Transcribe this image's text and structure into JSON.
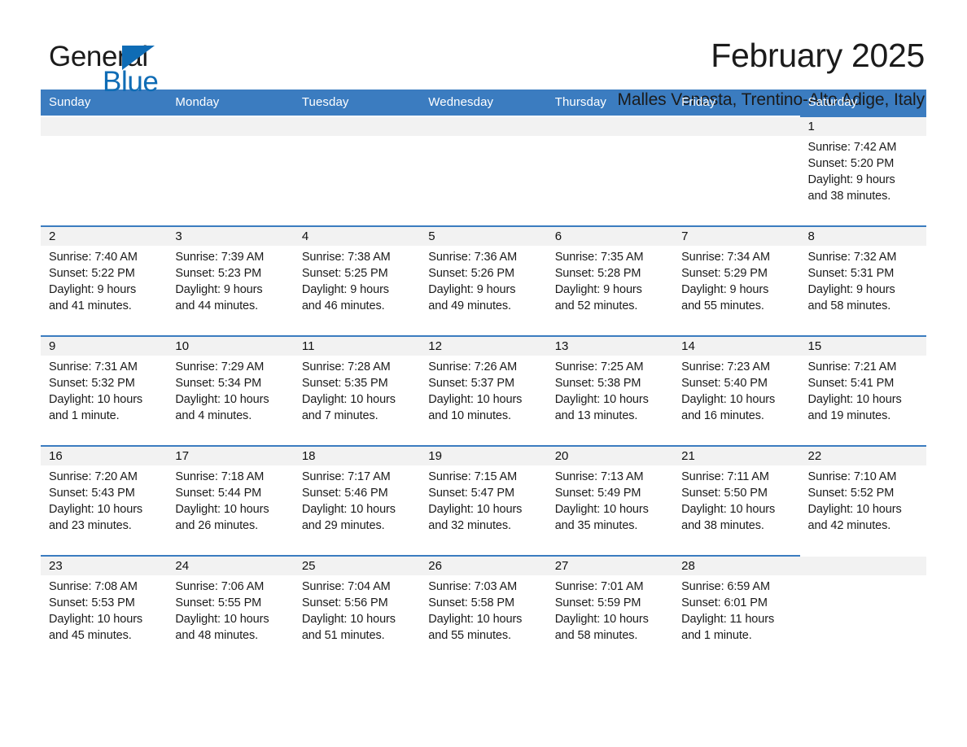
{
  "brand": {
    "name_first": "General",
    "name_second": "Blue",
    "accent_color": "#0f6cb5"
  },
  "header": {
    "title": "February 2025",
    "subtitle": "Malles Venosta, Trentino-Alto Adige, Italy"
  },
  "calendar": {
    "header_color": "#3b7cc0",
    "daynum_band_color": "#f2f2f2",
    "weekdays": [
      "Sunday",
      "Monday",
      "Tuesday",
      "Wednesday",
      "Thursday",
      "Friday",
      "Saturday"
    ],
    "weeks": [
      [
        {
          "empty": true
        },
        {
          "empty": true
        },
        {
          "empty": true
        },
        {
          "empty": true
        },
        {
          "empty": true
        },
        {
          "empty": true
        },
        {
          "day": "1",
          "sunrise": "Sunrise: 7:42 AM",
          "sunset": "Sunset: 5:20 PM",
          "daylight1": "Daylight: 9 hours",
          "daylight2": "and 38 minutes."
        }
      ],
      [
        {
          "day": "2",
          "sunrise": "Sunrise: 7:40 AM",
          "sunset": "Sunset: 5:22 PM",
          "daylight1": "Daylight: 9 hours",
          "daylight2": "and 41 minutes."
        },
        {
          "day": "3",
          "sunrise": "Sunrise: 7:39 AM",
          "sunset": "Sunset: 5:23 PM",
          "daylight1": "Daylight: 9 hours",
          "daylight2": "and 44 minutes."
        },
        {
          "day": "4",
          "sunrise": "Sunrise: 7:38 AM",
          "sunset": "Sunset: 5:25 PM",
          "daylight1": "Daylight: 9 hours",
          "daylight2": "and 46 minutes."
        },
        {
          "day": "5",
          "sunrise": "Sunrise: 7:36 AM",
          "sunset": "Sunset: 5:26 PM",
          "daylight1": "Daylight: 9 hours",
          "daylight2": "and 49 minutes."
        },
        {
          "day": "6",
          "sunrise": "Sunrise: 7:35 AM",
          "sunset": "Sunset: 5:28 PM",
          "daylight1": "Daylight: 9 hours",
          "daylight2": "and 52 minutes."
        },
        {
          "day": "7",
          "sunrise": "Sunrise: 7:34 AM",
          "sunset": "Sunset: 5:29 PM",
          "daylight1": "Daylight: 9 hours",
          "daylight2": "and 55 minutes."
        },
        {
          "day": "8",
          "sunrise": "Sunrise: 7:32 AM",
          "sunset": "Sunset: 5:31 PM",
          "daylight1": "Daylight: 9 hours",
          "daylight2": "and 58 minutes."
        }
      ],
      [
        {
          "day": "9",
          "sunrise": "Sunrise: 7:31 AM",
          "sunset": "Sunset: 5:32 PM",
          "daylight1": "Daylight: 10 hours",
          "daylight2": "and 1 minute."
        },
        {
          "day": "10",
          "sunrise": "Sunrise: 7:29 AM",
          "sunset": "Sunset: 5:34 PM",
          "daylight1": "Daylight: 10 hours",
          "daylight2": "and 4 minutes."
        },
        {
          "day": "11",
          "sunrise": "Sunrise: 7:28 AM",
          "sunset": "Sunset: 5:35 PM",
          "daylight1": "Daylight: 10 hours",
          "daylight2": "and 7 minutes."
        },
        {
          "day": "12",
          "sunrise": "Sunrise: 7:26 AM",
          "sunset": "Sunset: 5:37 PM",
          "daylight1": "Daylight: 10 hours",
          "daylight2": "and 10 minutes."
        },
        {
          "day": "13",
          "sunrise": "Sunrise: 7:25 AM",
          "sunset": "Sunset: 5:38 PM",
          "daylight1": "Daylight: 10 hours",
          "daylight2": "and 13 minutes."
        },
        {
          "day": "14",
          "sunrise": "Sunrise: 7:23 AM",
          "sunset": "Sunset: 5:40 PM",
          "daylight1": "Daylight: 10 hours",
          "daylight2": "and 16 minutes."
        },
        {
          "day": "15",
          "sunrise": "Sunrise: 7:21 AM",
          "sunset": "Sunset: 5:41 PM",
          "daylight1": "Daylight: 10 hours",
          "daylight2": "and 19 minutes."
        }
      ],
      [
        {
          "day": "16",
          "sunrise": "Sunrise: 7:20 AM",
          "sunset": "Sunset: 5:43 PM",
          "daylight1": "Daylight: 10 hours",
          "daylight2": "and 23 minutes."
        },
        {
          "day": "17",
          "sunrise": "Sunrise: 7:18 AM",
          "sunset": "Sunset: 5:44 PM",
          "daylight1": "Daylight: 10 hours",
          "daylight2": "and 26 minutes."
        },
        {
          "day": "18",
          "sunrise": "Sunrise: 7:17 AM",
          "sunset": "Sunset: 5:46 PM",
          "daylight1": "Daylight: 10 hours",
          "daylight2": "and 29 minutes."
        },
        {
          "day": "19",
          "sunrise": "Sunrise: 7:15 AM",
          "sunset": "Sunset: 5:47 PM",
          "daylight1": "Daylight: 10 hours",
          "daylight2": "and 32 minutes."
        },
        {
          "day": "20",
          "sunrise": "Sunrise: 7:13 AM",
          "sunset": "Sunset: 5:49 PM",
          "daylight1": "Daylight: 10 hours",
          "daylight2": "and 35 minutes."
        },
        {
          "day": "21",
          "sunrise": "Sunrise: 7:11 AM",
          "sunset": "Sunset: 5:50 PM",
          "daylight1": "Daylight: 10 hours",
          "daylight2": "and 38 minutes."
        },
        {
          "day": "22",
          "sunrise": "Sunrise: 7:10 AM",
          "sunset": "Sunset: 5:52 PM",
          "daylight1": "Daylight: 10 hours",
          "daylight2": "and 42 minutes."
        }
      ],
      [
        {
          "day": "23",
          "sunrise": "Sunrise: 7:08 AM",
          "sunset": "Sunset: 5:53 PM",
          "daylight1": "Daylight: 10 hours",
          "daylight2": "and 45 minutes."
        },
        {
          "day": "24",
          "sunrise": "Sunrise: 7:06 AM",
          "sunset": "Sunset: 5:55 PM",
          "daylight1": "Daylight: 10 hours",
          "daylight2": "and 48 minutes."
        },
        {
          "day": "25",
          "sunrise": "Sunrise: 7:04 AM",
          "sunset": "Sunset: 5:56 PM",
          "daylight1": "Daylight: 10 hours",
          "daylight2": "and 51 minutes."
        },
        {
          "day": "26",
          "sunrise": "Sunrise: 7:03 AM",
          "sunset": "Sunset: 5:58 PM",
          "daylight1": "Daylight: 10 hours",
          "daylight2": "and 55 minutes."
        },
        {
          "day": "27",
          "sunrise": "Sunrise: 7:01 AM",
          "sunset": "Sunset: 5:59 PM",
          "daylight1": "Daylight: 10 hours",
          "daylight2": "and 58 minutes."
        },
        {
          "day": "28",
          "sunrise": "Sunrise: 6:59 AM",
          "sunset": "Sunset: 6:01 PM",
          "daylight1": "Daylight: 11 hours",
          "daylight2": "and 1 minute."
        },
        {
          "empty": true
        }
      ]
    ]
  }
}
